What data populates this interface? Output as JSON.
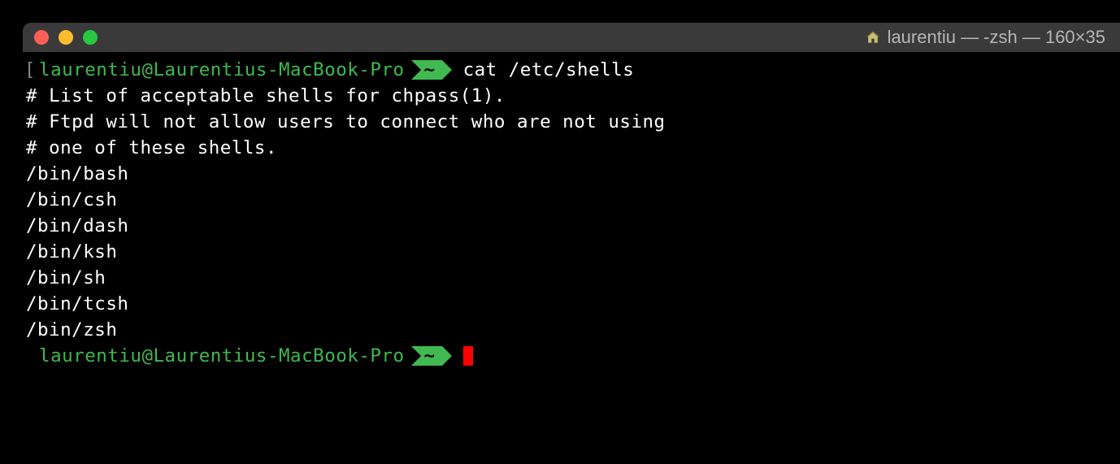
{
  "titlebar": {
    "title": "laurentiu — -zsh — 160×35"
  },
  "prompt": {
    "userhost": "laurentiu@Laurentius-MacBook-Pro",
    "badge": "~",
    "bracket": "["
  },
  "command1": "cat /etc/shells",
  "output": [
    "# List of acceptable shells for chpass(1).",
    "# Ftpd will not allow users to connect who are not using",
    "# one of these shells.",
    "",
    "/bin/bash",
    "/bin/csh",
    "/bin/dash",
    "/bin/ksh",
    "/bin/sh",
    "/bin/tcsh",
    "/bin/zsh"
  ]
}
